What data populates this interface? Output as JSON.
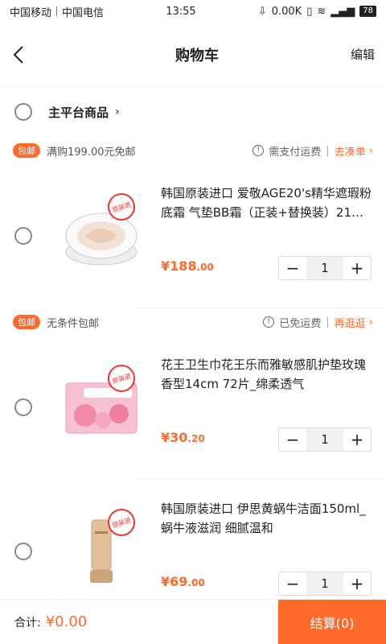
{
  "status": {
    "carrier1": "中国移动",
    "carrier2": "中国电信",
    "time": "13:55",
    "speed": "0.00K",
    "battery": "78"
  },
  "nav": {
    "title": "购物车",
    "edit": "编辑"
  },
  "section": {
    "title": "主平台商品",
    "chevron": "›"
  },
  "stores": [
    {
      "tag": "包邮",
      "condition": "满购199.00元免邮",
      "fee_text": "需支付运费",
      "link_text": "去凑单",
      "items": [
        {
          "name": "韩国原装进口 爱敬AGE20's精华遮瑕粉底霜 气垫BB霜（正装+替换装）21…",
          "price_int": "¥188",
          "price_dec": ".00",
          "qty": "1",
          "stamp": "原装进"
        }
      ]
    },
    {
      "tag": "包邮",
      "condition": "无条件包邮",
      "fee_text": "已免运费",
      "link_text": "再逛逛",
      "items": [
        {
          "name": "花王卫生巾花王乐而雅敏感肌护垫玫瑰香型14cm 72片_绵柔透气",
          "price_int": "¥30",
          "price_dec": ".20",
          "qty": "1",
          "stamp": "原装进"
        },
        {
          "name": "韩国原装进口 伊思黄蜗牛洁面150ml_蜗牛液滋润 细腻温和",
          "price_int": "¥69",
          "price_dec": ".00",
          "qty": "1",
          "stamp": "原装进"
        }
      ]
    }
  ],
  "footer": {
    "total_label": "合计:",
    "total_amount": "¥0.00",
    "checkout_label": "结算(0)"
  },
  "colors": {
    "accent": "#ff6a2a"
  }
}
